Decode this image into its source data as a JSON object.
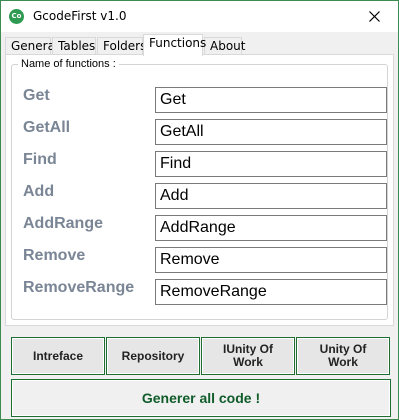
{
  "window": {
    "title": "GcodeFirst v1.0",
    "icon_text": "Co"
  },
  "tabs": [
    {
      "label": "General"
    },
    {
      "label": "Tables"
    },
    {
      "label": "Folders"
    },
    {
      "label": "Functions",
      "active": true
    },
    {
      "label": "About"
    }
  ],
  "group": {
    "title": "Name of functions :"
  },
  "functions": [
    {
      "label": "Get",
      "value": "Get"
    },
    {
      "label": "GetAll",
      "value": "GetAll"
    },
    {
      "label": "Find",
      "value": "Find"
    },
    {
      "label": "Add",
      "value": "Add"
    },
    {
      "label": "AddRange",
      "value": "AddRange"
    },
    {
      "label": "Remove",
      "value": "Remove"
    },
    {
      "label": "RemoveRange",
      "value": "RemoveRange"
    }
  ],
  "buttons": {
    "interface": "Intreface",
    "repository": "Repository",
    "iunity_line1": "IUnity Of",
    "iunity_line2": "Work",
    "unity_line1": "Unity Of",
    "unity_line2": "Work",
    "generate": "Generer all code !"
  },
  "colors": {
    "accent_border": "#1e6e33",
    "label_gray": "#7a8595",
    "generate_text": "#0f5c2a"
  }
}
